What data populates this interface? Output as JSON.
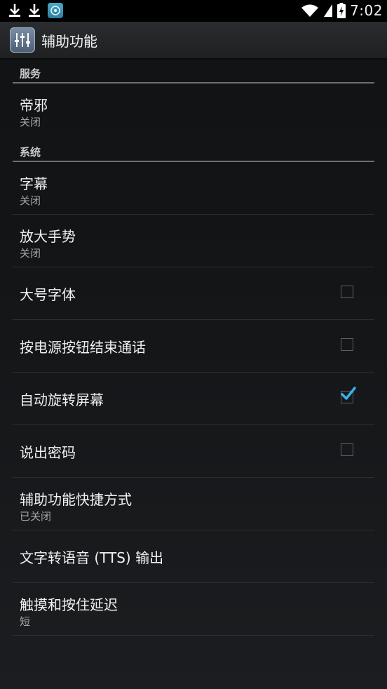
{
  "status_bar": {
    "time": "7:02",
    "icons": [
      "download-icon",
      "download-icon",
      "app-notification-icon",
      "wifi-icon",
      "signal-icon",
      "battery-charging-icon"
    ]
  },
  "action_bar": {
    "title": "辅助功能",
    "icon": "accessibility-settings-icon"
  },
  "sections": [
    {
      "header": "服务",
      "items": [
        {
          "title": "帝邪",
          "subtitle": "关闭"
        }
      ]
    },
    {
      "header": "系统",
      "items": [
        {
          "title": "字幕",
          "subtitle": "关闭"
        },
        {
          "title": "放大手势",
          "subtitle": "关闭"
        },
        {
          "title": "大号字体",
          "checked": false
        },
        {
          "title": "按电源按钮结束通话",
          "checked": false
        },
        {
          "title": "自动旋转屏幕",
          "checked": true
        },
        {
          "title": "说出密码",
          "checked": false
        },
        {
          "title": "辅助功能快捷方式",
          "subtitle": "已关闭"
        },
        {
          "title": "文字转语音 (TTS) 输出"
        },
        {
          "title": "触摸和按住延迟",
          "subtitle": "短"
        }
      ]
    }
  ],
  "colors": {
    "accent": "#33b5e5",
    "background": "#131517",
    "status_bar": "#000000"
  }
}
